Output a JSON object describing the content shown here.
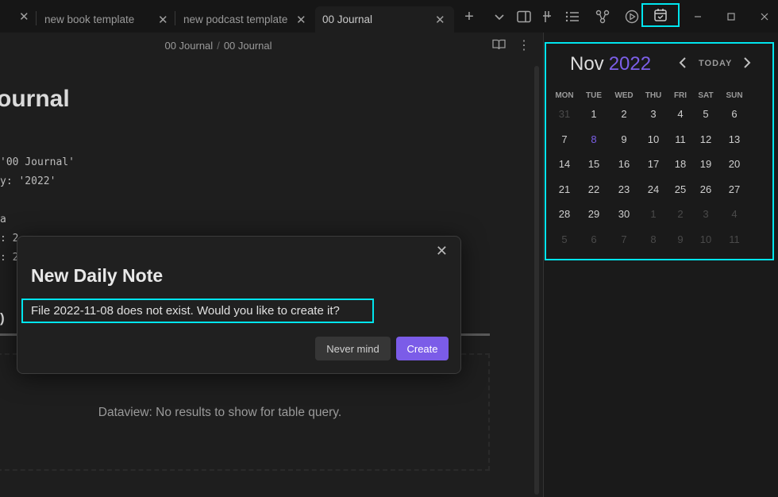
{
  "tabs": [
    {
      "label": "",
      "active": false
    },
    {
      "label": "new book template",
      "active": false
    },
    {
      "label": "new podcast template",
      "active": false
    },
    {
      "label": "00 Journal",
      "active": true
    }
  ],
  "breadcrumb": [
    "00 Journal",
    "00 Journal"
  ],
  "doc": {
    "title": "ournal",
    "code_lines": [
      "'00 Journal'",
      "y: '2022'",
      "",
      "a",
      ": 2",
      ": 2"
    ],
    "partial_heading": ")",
    "dataview_message": "Dataview: No results to show for table query."
  },
  "calendar": {
    "month": "Nov",
    "year": "2022",
    "today_label": "TODAY",
    "weekdays": [
      "MON",
      "TUE",
      "WED",
      "THU",
      "FRI",
      "SAT",
      "SUN"
    ],
    "weeks": [
      [
        "31",
        "1",
        "2",
        "3",
        "4",
        "5",
        "6"
      ],
      [
        "7",
        "8",
        "9",
        "10",
        "11",
        "12",
        "13"
      ],
      [
        "14",
        "15",
        "16",
        "17",
        "18",
        "19",
        "20"
      ],
      [
        "21",
        "22",
        "23",
        "24",
        "25",
        "26",
        "27"
      ],
      [
        "28",
        "29",
        "30",
        "1",
        "2",
        "3",
        "4"
      ],
      [
        "5",
        "6",
        "7",
        "8",
        "9",
        "10",
        "11"
      ]
    ],
    "today": "8",
    "accent_color": "#7c5fe8"
  },
  "modal": {
    "title": "New Daily Note",
    "message": "File 2022-11-08 does not exist. Would you like to create it?",
    "cancel_label": "Never mind",
    "create_label": "Create"
  },
  "icons": [
    "close-icon",
    "plus-icon",
    "chevron-down-icon",
    "sidebar-toggle-icon",
    "strikethrough-icon",
    "list-icon",
    "graph-icon",
    "play-icon",
    "calendar-check-icon",
    "minimize-icon",
    "maximize-icon",
    "window-close-icon",
    "book-open-icon",
    "more-vertical-icon"
  ]
}
